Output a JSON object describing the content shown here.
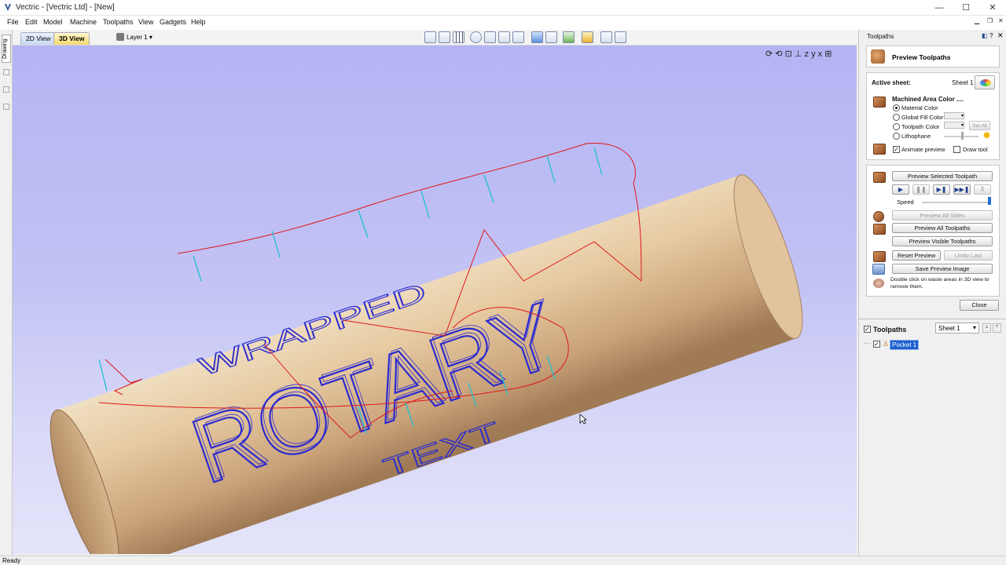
{
  "window": {
    "title": "Vectric - [Vectric Ltd] - [New]",
    "controls": [
      "—",
      "☐",
      "✕"
    ]
  },
  "menu": [
    "File",
    "Edit",
    "Model",
    "Machine",
    "Toolpaths",
    "View",
    "Gadgets",
    "Help"
  ],
  "tabs": {
    "view_2d": "2D View",
    "view_3d": "3D View",
    "layer": "Layer 1"
  },
  "left_strip": {
    "drawing_tab": "Drawing"
  },
  "viewport": {
    "texts": {
      "main": "ROTARY",
      "top": "WRAPPED",
      "bottom": "TEXT"
    },
    "colors": {
      "wood_light": "#e6c9a0",
      "wood_dark": "#b8916a",
      "toolpath": "#2a2ad0",
      "rapid": "#e01818",
      "plunge": "#20c0d0"
    }
  },
  "panel": {
    "header": "Toolpaths",
    "title": "Preview Toolpaths",
    "active_sheet_label": "Active sheet:",
    "active_sheet_value": "Sheet 1",
    "machined_area_color": "Machined Area Color ....",
    "options": {
      "material_color": "Material Color",
      "global_fill_color": "Global Fill Color",
      "toolpath_color": "Toolpath Color",
      "lithophane": "Lithophane",
      "set_all": "Set All"
    },
    "animate_preview": "Animate preview",
    "draw_tool": "Draw tool",
    "buttons": {
      "preview_selected": "Preview Selected Toolpath",
      "speed": "Speed",
      "preview_all_sides": "Preview All Sides",
      "preview_all_toolpaths": "Preview All Toolpaths",
      "preview_visible_toolpaths": "Preview Visible Toolpaths",
      "reset_preview": "Reset Preview",
      "undo_last": "Undo Last",
      "save_preview_image": "Save Preview Image",
      "close": "Close"
    },
    "hint": "Double click on waste areas in 3D view to remove them.",
    "toolpaths_list": {
      "title": "Toolpaths",
      "sheet": "Sheet 1",
      "items": [
        "Pocket 1"
      ]
    }
  },
  "status": "Ready"
}
